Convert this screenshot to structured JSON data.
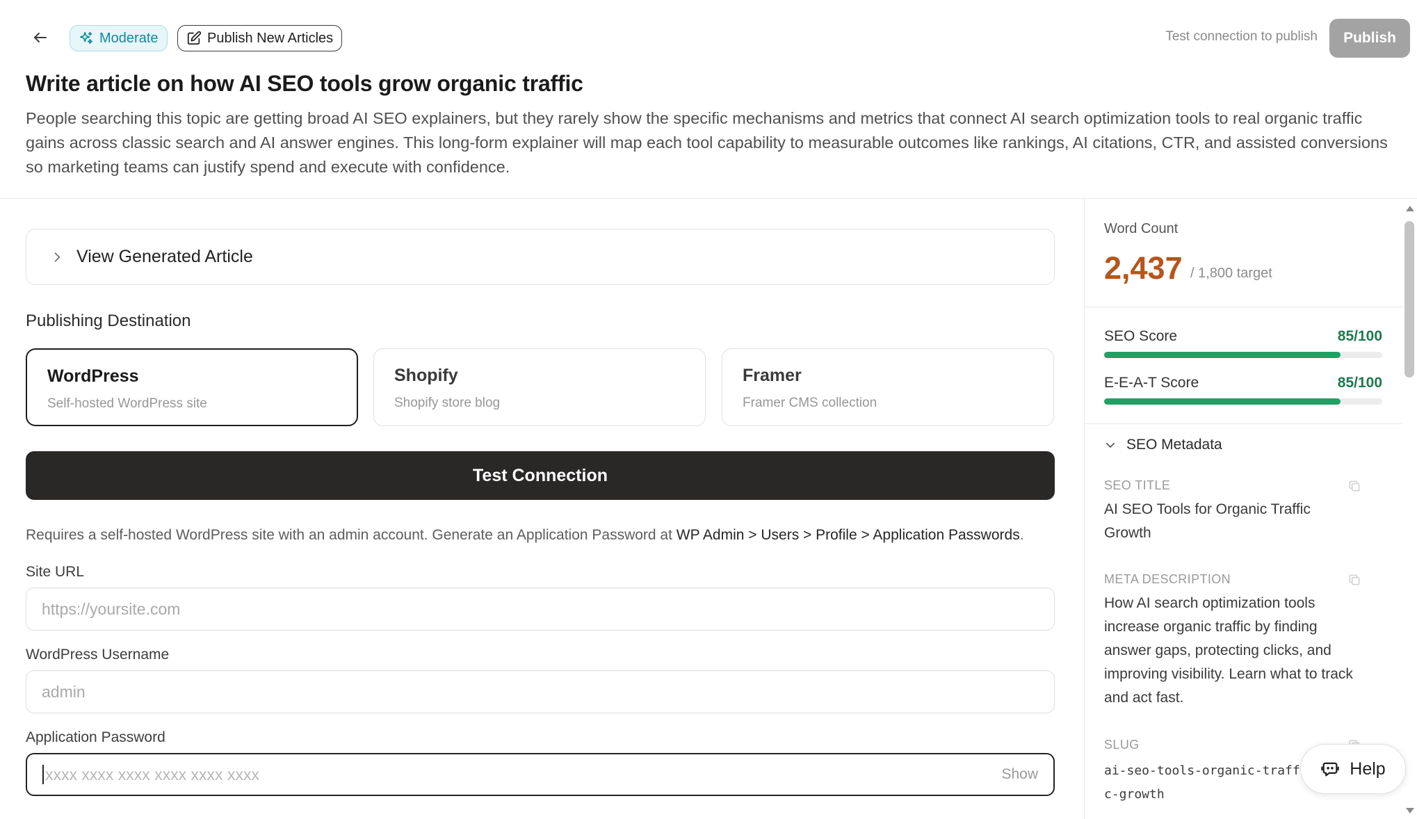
{
  "header": {
    "difficulty_badge": "Moderate",
    "mode_chip": "Publish New Articles",
    "publish_hint": "Test connection to publish",
    "publish_label": "Publish"
  },
  "article": {
    "title": "Write article on how AI SEO tools grow organic traffic",
    "description": "People searching this topic are getting broad AI SEO explainers, but they rarely show the specific mechanisms and metrics that connect AI search optimization tools to real organic traffic gains across classic search and AI answer engines. This long-form explainer will map each tool capability to measurable outcomes like rankings, AI citations, CTR, and assisted conversions so marketing teams can justify spend and execute with confidence."
  },
  "main": {
    "view_article_label": "View Generated Article",
    "publishing_destination_label": "Publishing Destination",
    "destinations": [
      {
        "name": "WordPress",
        "sub": "Self-hosted WordPress site",
        "selected": true
      },
      {
        "name": "Shopify",
        "sub": "Shopify store blog",
        "selected": false
      },
      {
        "name": "Framer",
        "sub": "Framer CMS collection",
        "selected": false
      }
    ],
    "test_connection_label": "Test Connection",
    "requirement_note_prefix": "Requires a self-hosted WordPress site with an admin account. Generate an Application Password at ",
    "requirement_note_path": "WP Admin > Users > Profile > Application Passwords",
    "requirement_note_suffix": ".",
    "fields": {
      "site_url": {
        "label": "Site URL",
        "placeholder": "https://yoursite.com"
      },
      "username": {
        "label": "WordPress Username",
        "placeholder": "admin"
      },
      "app_password": {
        "label": "Application Password",
        "placeholder": "xxxx xxxx xxxx xxxx xxxx xxxx",
        "toggle_label": "Show"
      }
    }
  },
  "sidebar": {
    "word_count_label": "Word Count",
    "word_count_value": "2,437",
    "word_count_target": "/ 1,800 target",
    "seo_score_label": "SEO Score",
    "seo_score_value": "85/100",
    "seo_score_fraction": 0.85,
    "eeat_score_label": "E-E-A-T Score",
    "eeat_score_value": "85/100",
    "eeat_score_fraction": 0.85,
    "metadata_label": "SEO Metadata",
    "seo_title_key": "SEO TITLE",
    "seo_title_value": "AI SEO Tools for Organic Traffic Growth",
    "meta_description_key": "META DESCRIPTION",
    "meta_description_value": "How AI search optimization tools increase organic traffic by finding answer gaps, protecting clicks, and improving visibility. Learn what to track and act fast.",
    "slug_key": "SLUG",
    "slug_value": "ai-seo-tools-organic-traffic-growth"
  },
  "help_label": "Help",
  "colors": {
    "accent_teal": "#15889d",
    "word_count_orange": "#b5561b",
    "score_green": "#1fa164",
    "primary_dark": "#2a2727",
    "publish_disabled": "#a3a3a3"
  },
  "icons": {
    "back": "arrow-left-icon",
    "moderate": "sparkles-icon",
    "publish_new": "edit-square-icon",
    "expander": "chevron-right-icon",
    "metadata": "chevron-down-icon",
    "copy": "copy-icon",
    "help": "chat-bot-icon"
  }
}
